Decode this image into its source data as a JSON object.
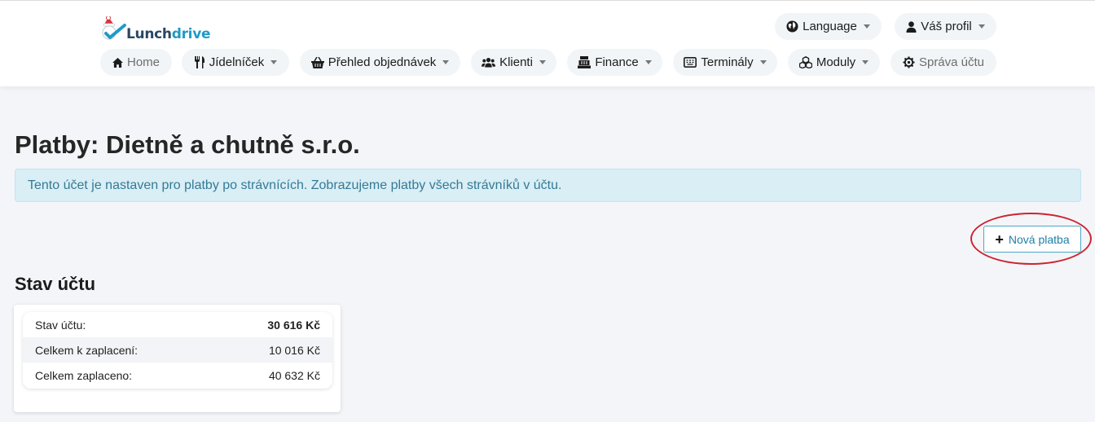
{
  "brand": {
    "name_part1": "Lunch",
    "name_part2": "drive"
  },
  "header": {
    "language_label": "Language",
    "profile_label": "Váš profil"
  },
  "nav": {
    "home": "Home",
    "menu": "Jídelníček",
    "orders": "Přehled objednávek",
    "clients": "Klienti",
    "finance": "Finance",
    "terminals": "Terminály",
    "modules": "Moduly",
    "account": "Správa účtu"
  },
  "page": {
    "title": "Platby: Dietně a chutně s.r.o.",
    "alert": "Tento účet je nastaven pro platby po strávnících. Zobrazujeme platby všech strávníků v účtu.",
    "new_payment_label": "Nová platba"
  },
  "account_status": {
    "title": "Stav účtu",
    "rows": [
      {
        "label": "Stav účtu:",
        "value": "30 616 Kč"
      },
      {
        "label": "Celkem k zaplacení:",
        "value": "10 016 Kč"
      },
      {
        "label": "Celkem zaplaceno:",
        "value": "40 632 Kč"
      }
    ]
  },
  "colors": {
    "accent": "#1f9bc6",
    "alert_bg": "#d9eef5",
    "alert_text": "#357a96",
    "highlight": "#cc2530"
  }
}
